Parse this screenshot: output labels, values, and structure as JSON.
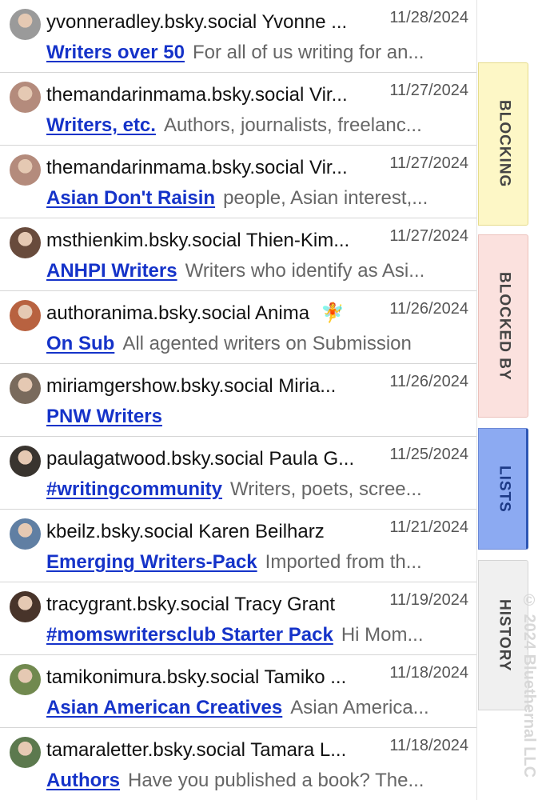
{
  "items": [
    {
      "handle": "yvonneradley.bsky.social Yvonne ...",
      "date": "11/28/2024",
      "list_name": "Writers over 50",
      "description": "For all of us writing for an...",
      "avatar_color": "#9a9a9a"
    },
    {
      "handle": "themandarinmama.bsky.social Vir...",
      "date": "11/27/2024",
      "list_name": "Writers, etc.",
      "description": "Authors, journalists, freelanc...",
      "avatar_color": "#b88a7a"
    },
    {
      "handle": "themandarinmama.bsky.social Vir...",
      "date": "11/27/2024",
      "list_name": "Asian Don't Raisin",
      "description": "people, Asian interest,...",
      "avatar_color": "#b88a7a"
    },
    {
      "handle": "msthienkim.bsky.social Thien-Kim...",
      "date": "11/27/2024",
      "list_name": "ANHPI Writers",
      "description": "Writers who identify as Asi...",
      "avatar_color": "#6b4a3a"
    },
    {
      "handle": "authoranima.bsky.social Anima",
      "handle_emoji": "🧚",
      "date": "11/26/2024",
      "list_name": "On Sub",
      "description": "All agented writers on Submission",
      "avatar_color": "#c0603a"
    },
    {
      "handle": "miriamgershow.bsky.social Miria...",
      "date": "11/26/2024",
      "list_name": "PNW Writers",
      "description": "",
      "avatar_color": "#7a6a5a"
    },
    {
      "handle": "paulagatwood.bsky.social Paula G...",
      "date": "11/25/2024",
      "list_name": "#writingcommunity",
      "description": "Writers, poets, scree...",
      "avatar_color": "#3a342e"
    },
    {
      "handle": "kbeilz.bsky.social Karen Beilharz",
      "date": "11/21/2024",
      "list_name": "Emerging Writers-Pack",
      "description": "Imported from th...",
      "avatar_color": "#5d7fa8"
    },
    {
      "handle": "tracygrant.bsky.social Tracy Grant",
      "date": "11/19/2024",
      "list_name": "#momswritersclub Starter Pack",
      "description": "Hi Mom...",
      "avatar_color": "#4a3428"
    },
    {
      "handle": "tamikonimura.bsky.social Tamiko ...",
      "date": "11/18/2024",
      "list_name": "Asian American Creatives",
      "description": "Asian America...",
      "avatar_color": "#6f8a4a"
    },
    {
      "handle": "tamaraletter.bsky.social Tamara L...",
      "date": "11/18/2024",
      "list_name": "Authors",
      "description": "Have you published a book? The...",
      "avatar_color": "#5a7a4a"
    }
  ],
  "tabs": {
    "blocking": "BLOCKING",
    "blocked_by": "BLOCKED BY",
    "lists": "LISTS",
    "history": "HISTORY"
  },
  "copyright": "© 2024 Bluethernal LLC",
  "colors": {
    "link": "#1533c9",
    "blocking_tab": "#fdf7c6",
    "blocked_by_tab": "#fbe1de",
    "lists_tab": "#8caaf2",
    "history_tab": "#f0f0f0"
  }
}
